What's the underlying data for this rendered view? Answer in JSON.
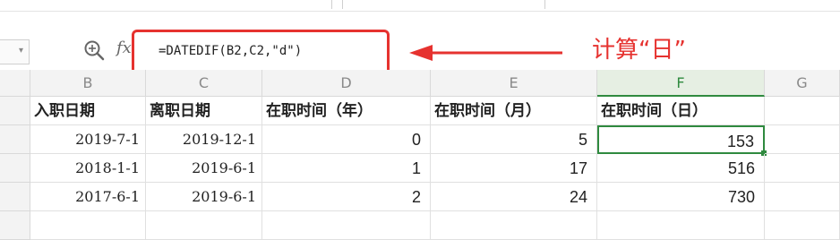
{
  "formula_bar": {
    "formula": "=DATEDIF(B2,C2,\"d\")",
    "fx_label": "fx",
    "zoom_icon": "zoom-search-icon"
  },
  "annotation": {
    "note": "计算“日”",
    "color": "#e6322f"
  },
  "columns": [
    "B",
    "C",
    "D",
    "E",
    "F",
    "G"
  ],
  "active_column": "F",
  "headers": [
    "入职日期",
    "离职日期",
    "在职时间（年）",
    "在职时间（月）",
    "在职时间（日）"
  ],
  "rows": [
    [
      "2019-7-1",
      "2019-12-1",
      "0",
      "5",
      "153"
    ],
    [
      "2018-1-1",
      "2019-6-1",
      "1",
      "17",
      "516"
    ],
    [
      "2017-6-1",
      "2019-6-1",
      "2",
      "24",
      "730"
    ]
  ],
  "colors": {
    "selection": "#2f8a3f",
    "annotation_red": "#e6322f"
  }
}
